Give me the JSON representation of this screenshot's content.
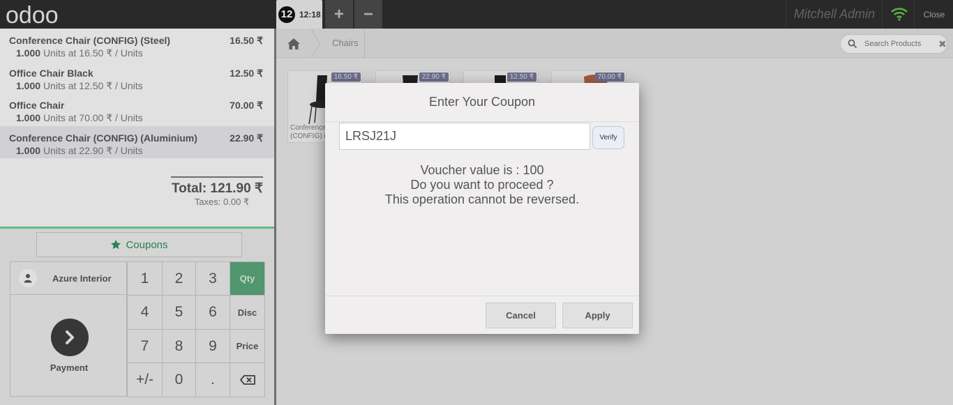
{
  "header": {
    "logo_text": "odoo",
    "order_number": "12",
    "order_time": "12:18",
    "add_label": "+",
    "remove_label": "−",
    "user": "Mitchell Admin",
    "close_label": "Close"
  },
  "orderlines": [
    {
      "name": "Conference Chair (CONFIG) (Steel)",
      "price": "16.50 ₹",
      "qty": "1.000",
      "info": "Units at 16.50 ₹ / Units"
    },
    {
      "name": "Office Chair Black",
      "price": "12.50 ₹",
      "qty": "1.000",
      "info": "Units at 12.50 ₹ / Units"
    },
    {
      "name": "Office Chair",
      "price": "70.00 ₹",
      "qty": "1.000",
      "info": "Units at 70.00 ₹ / Units"
    },
    {
      "name": "Conference Chair (CONFIG) (Aluminium)",
      "price": "22.90 ₹",
      "qty": "1.000",
      "info": "Units at 22.90 ₹ / Units"
    }
  ],
  "summary": {
    "total": "Total: 121.90 ₹",
    "taxes": "Taxes: 0.00 ₹"
  },
  "controls": {
    "coupons_label": "Coupons",
    "customer": "Azure Interior",
    "payment_label": "Payment",
    "keys": [
      "1",
      "2",
      "3",
      "Qty",
      "4",
      "5",
      "6",
      "Disc",
      "7",
      "8",
      "9",
      "Price",
      "+/-",
      "0",
      "."
    ],
    "active_mode": "Qty"
  },
  "breadcrumb": {
    "category": "Chairs"
  },
  "search": {
    "placeholder": "Search Products"
  },
  "products": [
    {
      "price": "16.50 ₹",
      "name_line1": "Conference",
      "name_line2": "(CONFIG) (S"
    },
    {
      "price": "22.90 ₹"
    },
    {
      "price": "12.50 ₹"
    },
    {
      "price": "70.00 ₹"
    }
  ],
  "modal": {
    "title": "Enter Your Coupon",
    "coupon_value": "LRSJ21J",
    "verify_label": "Verify",
    "message_line1": "Voucher value is : 100",
    "message_line2": "Do you want to proceed ?",
    "message_line3": "This operation cannot be reversed.",
    "cancel_label": "Cancel",
    "apply_label": "Apply"
  },
  "colors": {
    "accent_green": "#58a377",
    "coupon_green": "#2a8c5a",
    "price_badge": "#77779a",
    "topbar": "#2d2d2d"
  }
}
